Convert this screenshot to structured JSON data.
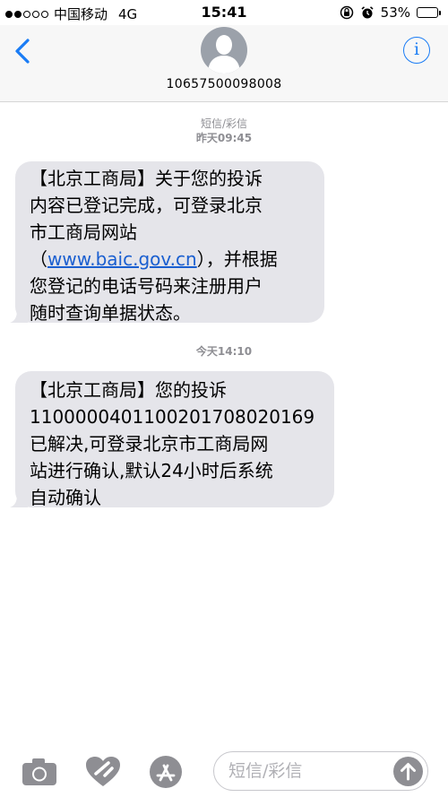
{
  "status_bar": {
    "carrier": "中国移动",
    "network": "4G",
    "time": "15:41",
    "battery": "53%",
    "battery_level": 0.53,
    "icons": [
      "signal-dots-icon",
      "rotation-lock-icon",
      "alarm-icon",
      "battery-icon"
    ]
  },
  "header": {
    "contact": "10657500098008",
    "back_icon": "chevron-left-icon",
    "info_icon": "info-icon",
    "avatar_icon": "person-silhouette-icon"
  },
  "messages": [
    {
      "meta_type": "短信/彩信",
      "meta_time": "昨天09:45",
      "lines": [
        "【北京工商局】关于您的投诉",
        "内容已登记完成，可登录北京",
        "市工商局网站",
        "（",
        "www.baic.gov.cn",
        "），并根据",
        "您登记的电话号码来注册用户",
        "随时查询单据状态。"
      ]
    },
    {
      "meta_time": "今天14:10",
      "lines": [
        "【北京工商局】您的投诉",
        "110000040110020170802016​9",
        "已解决,可登录北京市工商局网",
        "站进行确认,默认24小时后系统",
        "自动确认"
      ]
    }
  ],
  "composer": {
    "placeholder": "短信/彩信",
    "icons": [
      "camera-icon",
      "digital-touch-icon",
      "app-store-icon",
      "send-arrow-icon"
    ]
  },
  "colors": {
    "accent": "#1a7cf5",
    "bubble": "#e5e5ea",
    "meta_text": "#8e8e93"
  }
}
